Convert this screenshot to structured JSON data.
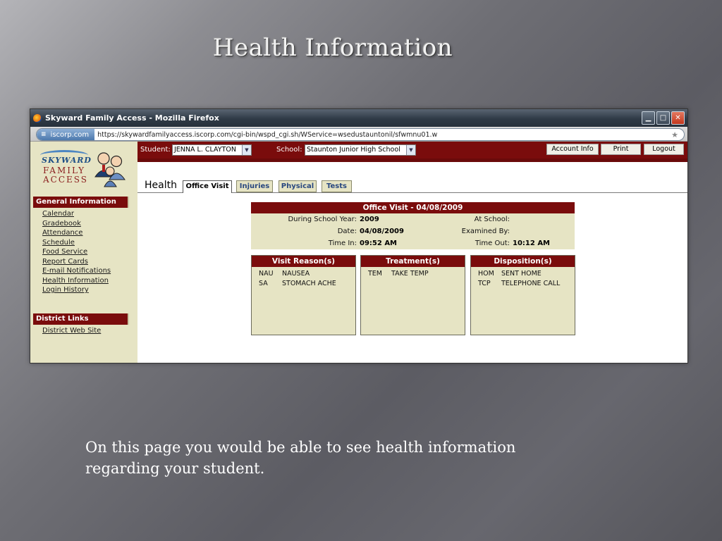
{
  "slide": {
    "title": "Health Information",
    "caption": "On this page you would be able to see health information regarding your student."
  },
  "browser": {
    "window_title": "Skyward Family Access - Mozilla Firefox",
    "site_identity": "iscorp.com",
    "url": "https://skywardfamilyaccess.iscorp.com/cgi-bin/wspd_cgi.sh/WService=wsedustauntonil/sfwmnu01.w"
  },
  "logo": {
    "line1": "SKYWARD",
    "line2": "FAMILY",
    "line3": "ACCESS"
  },
  "sidebar": {
    "general_header": "General Information",
    "general_items": [
      "Calendar",
      "Gradebook",
      "Attendance",
      "Schedule",
      "Food Service",
      "Report Cards",
      "E-mail Notifications",
      "Health Information",
      "Login History"
    ],
    "district_header": "District Links",
    "district_items": [
      "District Web Site"
    ]
  },
  "topbar": {
    "student_label": "Student:",
    "student_value": "JENNA L. CLAYTON",
    "school_label": "School:",
    "school_value": "Staunton Junior High School",
    "account_info": "Account Info",
    "print": "Print",
    "logout": "Logout"
  },
  "tabs": {
    "section_label": "Health",
    "items": [
      "Office Visit",
      "Injuries",
      "Physical",
      "Tests"
    ],
    "active": "Office Visit"
  },
  "office_visit": {
    "header": "Office Visit - 04/08/2009",
    "school_year_label": "During School Year:",
    "school_year": "2009",
    "at_school_label": "At School:",
    "at_school": "",
    "date_label": "Date:",
    "date": "04/08/2009",
    "examined_by_label": "Examined By:",
    "examined_by": "",
    "time_in_label": "Time In:",
    "time_in": "09:52 AM",
    "time_out_label": "Time Out:",
    "time_out": "10:12 AM"
  },
  "panels": {
    "visit_reasons": {
      "header": "Visit Reason(s)",
      "rows": [
        {
          "code": "NAU",
          "desc": "NAUSEA"
        },
        {
          "code": "SA",
          "desc": "STOMACH ACHE"
        }
      ]
    },
    "treatments": {
      "header": "Treatment(s)",
      "rows": [
        {
          "code": "TEM",
          "desc": "TAKE TEMP"
        }
      ]
    },
    "dispositions": {
      "header": "Disposition(s)",
      "rows": [
        {
          "code": "HOM",
          "desc": "SENT HOME"
        },
        {
          "code": "TCP",
          "desc": "TELEPHONE CALL"
        }
      ]
    }
  },
  "colors": {
    "brand_maroon": "#7a0c0c",
    "panel_tan": "#e6e4c4",
    "tab_blue": "#28477f"
  }
}
